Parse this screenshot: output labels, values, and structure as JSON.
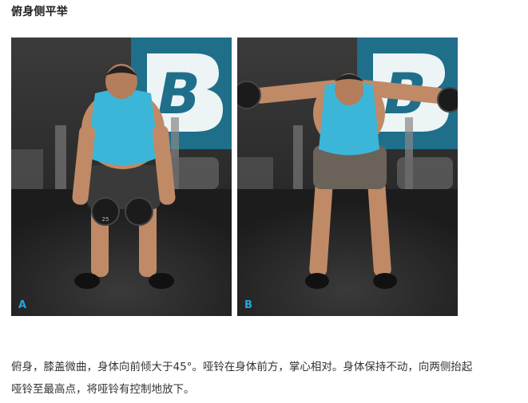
{
  "title": "俯身侧平举",
  "photos": [
    {
      "label": "A",
      "brand_mark": "B",
      "weight_plate_text": "25"
    },
    {
      "label": "B",
      "brand_mark": "B"
    }
  ],
  "description": {
    "line1": "俯身，膝盖微曲，身体向前倾大于45°。哑铃在身体前方，掌心相对。身体保持不动，向两侧抬起",
    "line2": "哑铃至最高点，将哑铃有控制地放下。"
  },
  "colors": {
    "label": "#26a7e0",
    "tank_top": "#3cb6d8",
    "wall_logo": "#1f6f8b"
  }
}
